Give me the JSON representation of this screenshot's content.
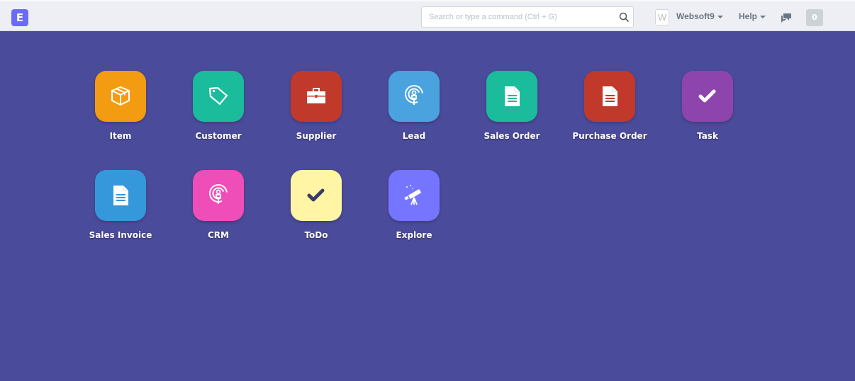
{
  "navbar": {
    "logo": "E",
    "search_placeholder": "Search or type a command (Ctrl + G)",
    "avatar_initial": "W",
    "user": "Websoft9",
    "help": "Help",
    "notifications": "0"
  },
  "modules": [
    {
      "label": "Item",
      "icon": "box-icon",
      "color": "#f39c12",
      "fg": "#ffffff"
    },
    {
      "label": "Customer",
      "icon": "tag-icon",
      "color": "#1abc9c",
      "fg": "#ffffff"
    },
    {
      "label": "Supplier",
      "icon": "briefcase-icon",
      "color": "#c0392b",
      "fg": "#ffffff"
    },
    {
      "label": "Lead",
      "icon": "broadcast-icon",
      "color": "#4aa3df",
      "fg": "#ffffff"
    },
    {
      "label": "Sales Order",
      "icon": "document-icon",
      "color": "#1abc9c",
      "fg": "#ffffff"
    },
    {
      "label": "Purchase Order",
      "icon": "document-icon",
      "color": "#c0392b",
      "fg": "#ffffff"
    },
    {
      "label": "Task",
      "icon": "check-icon",
      "color": "#8e44ad",
      "fg": "#ffffff"
    },
    {
      "label": "Sales Invoice",
      "icon": "document-icon",
      "color": "#3498db",
      "fg": "#ffffff"
    },
    {
      "label": "CRM",
      "icon": "broadcast-icon",
      "color": "#ef4db8",
      "fg": "#ffffff"
    },
    {
      "label": "ToDo",
      "icon": "check-icon",
      "color": "#fff5a5",
      "fg": "#3a3a6a"
    },
    {
      "label": "Explore",
      "icon": "telescope-icon",
      "color": "#7575ff",
      "fg": "#ffffff"
    }
  ]
}
